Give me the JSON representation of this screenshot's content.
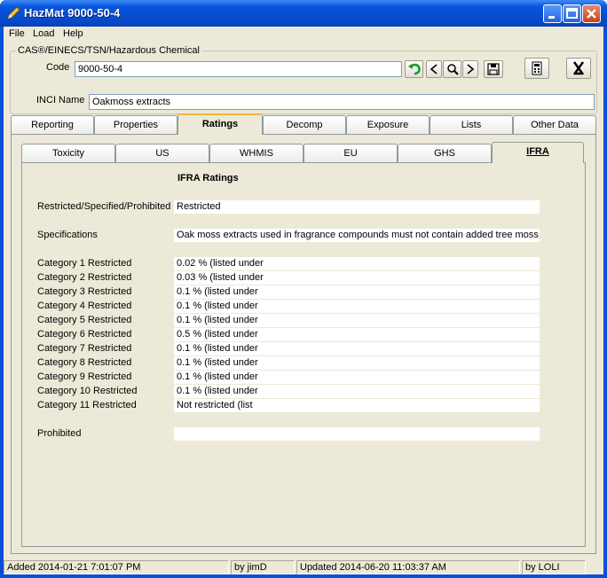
{
  "window": {
    "title": "HazMat 9000-50-4"
  },
  "menu": [
    "File",
    "Load",
    "Help"
  ],
  "group_title": "CAS®/EINECS/TSN/Hazardous Chemical",
  "code": {
    "label": "Code",
    "value": "9000-50-4"
  },
  "inci": {
    "label": "INCI Name",
    "value": "Oakmoss extracts"
  },
  "main_tabs": [
    "Reporting",
    "Properties",
    "Ratings",
    "Decomp",
    "Exposure",
    "Lists",
    "Other Data"
  ],
  "main_active": "Ratings",
  "sub_tabs": [
    "Toxicity",
    "US",
    "WHMIS",
    "EU",
    "GHS",
    "IFRA"
  ],
  "sub_active": "IFRA",
  "ifra": {
    "heading": "IFRA Ratings",
    "rows": [
      {
        "label": "Restricted/Specified/Prohibited",
        "value": "Restricted"
      },
      {
        "label": "Specifications",
        "value": "Oak moss extracts used in fragrance compounds must not contain added tree moss, wh"
      },
      {
        "label": "Category 1 Restricted",
        "value": "0.02 % (listed under"
      },
      {
        "label": "Category 2 Restricted",
        "value": "0.03 % (listed under"
      },
      {
        "label": "Category 3 Restricted",
        "value": "0.1 % (listed under"
      },
      {
        "label": "Category 4 Restricted",
        "value": "0.1 % (listed under"
      },
      {
        "label": "Category 5 Restricted",
        "value": "0.1 % (listed under"
      },
      {
        "label": "Category 6 Restricted",
        "value": "0.5 % (listed under"
      },
      {
        "label": "Category 7 Restricted",
        "value": "0.1 % (listed under"
      },
      {
        "label": "Category 8 Restricted",
        "value": "0.1 % (listed under"
      },
      {
        "label": "Category 9 Restricted",
        "value": "0.1 % (listed under"
      },
      {
        "label": "Category 10 Restricted",
        "value": "0.1 % (listed under"
      },
      {
        "label": "Category 11 Restricted",
        "value": "Not restricted (list"
      },
      {
        "label": "Prohibited",
        "value": ""
      }
    ]
  },
  "status": {
    "added": "Added 2014-01-21 7:01:07 PM",
    "added_by": "by jimD",
    "updated": "Updated 2014-06-20 11:03:37 AM",
    "updated_by": "by LOLI"
  },
  "colors": {
    "titlebar": "#0855dd",
    "face": "#ece9d8",
    "tab_highlight": "#f6b53f",
    "nav_green": "#1a9a2a"
  },
  "icons": [
    "pencil-icon",
    "minimize-icon",
    "maximize-icon",
    "close-icon",
    "undo-icon",
    "prev-icon",
    "search-icon",
    "next-icon",
    "save-icon",
    "calculator-icon",
    "hazmat-icon"
  ]
}
